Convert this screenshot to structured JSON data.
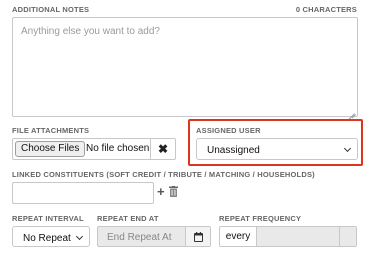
{
  "notes": {
    "label": "ADDITIONAL NOTES",
    "char_count": "0 CHARACTERS",
    "placeholder": "Anything else you want to add?"
  },
  "attachments": {
    "label": "FILE ATTACHMENTS",
    "choose_label": "Choose Files",
    "status": "No file chosen",
    "clear_icon": "times-icon"
  },
  "assigned_user": {
    "label": "ASSIGNED USER",
    "value": "Unassigned",
    "highlight_color": "#d9381e"
  },
  "linked_constituents": {
    "label": "LINKED CONSTITUENTS (SOFT CREDIT / TRIBUTE / MATCHING / HOUSEHOLDS)",
    "add_icon": "plus-icon",
    "remove_icon": "trash-icon"
  },
  "repeat_interval": {
    "label": "REPEAT INTERVAL",
    "value": "No Repeat"
  },
  "repeat_end": {
    "label": "REPEAT END AT",
    "placeholder": "End Repeat At",
    "icon": "calendar-icon"
  },
  "repeat_frequency": {
    "label": "REPEAT FREQUENCY",
    "prefix": "every"
  }
}
